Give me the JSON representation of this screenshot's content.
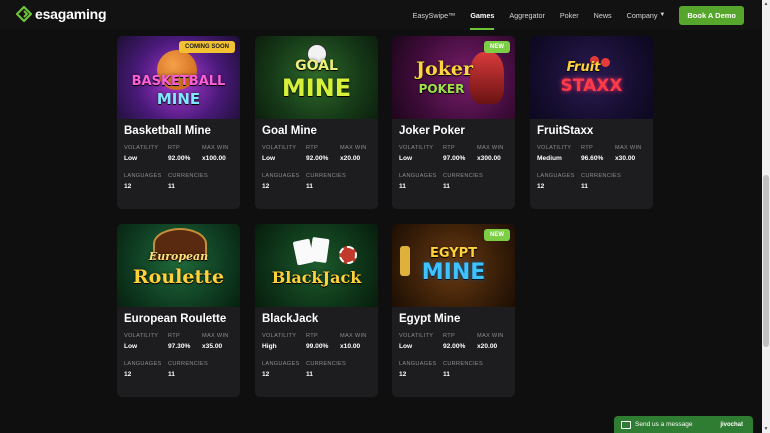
{
  "brand": {
    "name": "esagaming",
    "accent": "#6ec23a"
  },
  "nav": {
    "items": [
      {
        "label": "EasySwipe™",
        "active": false
      },
      {
        "label": "Games",
        "active": true
      },
      {
        "label": "Aggregator",
        "active": false
      },
      {
        "label": "Poker",
        "active": false
      },
      {
        "label": "News",
        "active": false
      },
      {
        "label": "Company",
        "active": false
      }
    ],
    "cta": "Book A Demo"
  },
  "labels": {
    "volatility": "VOLATILITY",
    "rtp": "RTP",
    "max_win": "MAX WIN",
    "languages": "LANGUAGES",
    "currencies": "CURRENCIES"
  },
  "games": [
    {
      "title": "Basketball Mine",
      "art_line1": "BASKETBALL",
      "art_line2": "MINE",
      "badge": "COMING SOON",
      "volatility": "Low",
      "rtp": "92.00%",
      "max_win": "x100.00",
      "languages": "12",
      "currencies": "11"
    },
    {
      "title": "Goal Mine",
      "art_line1": "GOAL",
      "art_line2": "MINE",
      "badge": "",
      "volatility": "Low",
      "rtp": "92.00%",
      "max_win": "x20.00",
      "languages": "12",
      "currencies": "11"
    },
    {
      "title": "Joker Poker",
      "art_line1": "Joker",
      "art_line2": "POKER",
      "badge": "NEW",
      "volatility": "Low",
      "rtp": "97.00%",
      "max_win": "x300.00",
      "languages": "11",
      "currencies": "11"
    },
    {
      "title": "FruitStaxx",
      "art_line1": "Fruit",
      "art_line2": "STAXX",
      "badge": "",
      "volatility": "Medium",
      "rtp": "96.60%",
      "max_win": "x30.00",
      "languages": "12",
      "currencies": "11"
    },
    {
      "title": "European Roulette",
      "art_line1": "European",
      "art_line2": "Roulette",
      "badge": "",
      "volatility": "Low",
      "rtp": "97.30%",
      "max_win": "x35.00",
      "languages": "12",
      "currencies": "11"
    },
    {
      "title": "BlackJack",
      "art_line1": "",
      "art_line2": "BlackJack",
      "badge": "",
      "volatility": "High",
      "rtp": "99.00%",
      "max_win": "x10.00",
      "languages": "12",
      "currencies": "11"
    },
    {
      "title": "Egypt Mine",
      "art_line1": "EGYPT",
      "art_line2": "MINE",
      "badge": "NEW",
      "volatility": "Low",
      "rtp": "92.00%",
      "max_win": "x20.00",
      "languages": "12",
      "currencies": "11"
    }
  ],
  "chat": {
    "text": "Send us a message",
    "brand": "jivochat"
  }
}
